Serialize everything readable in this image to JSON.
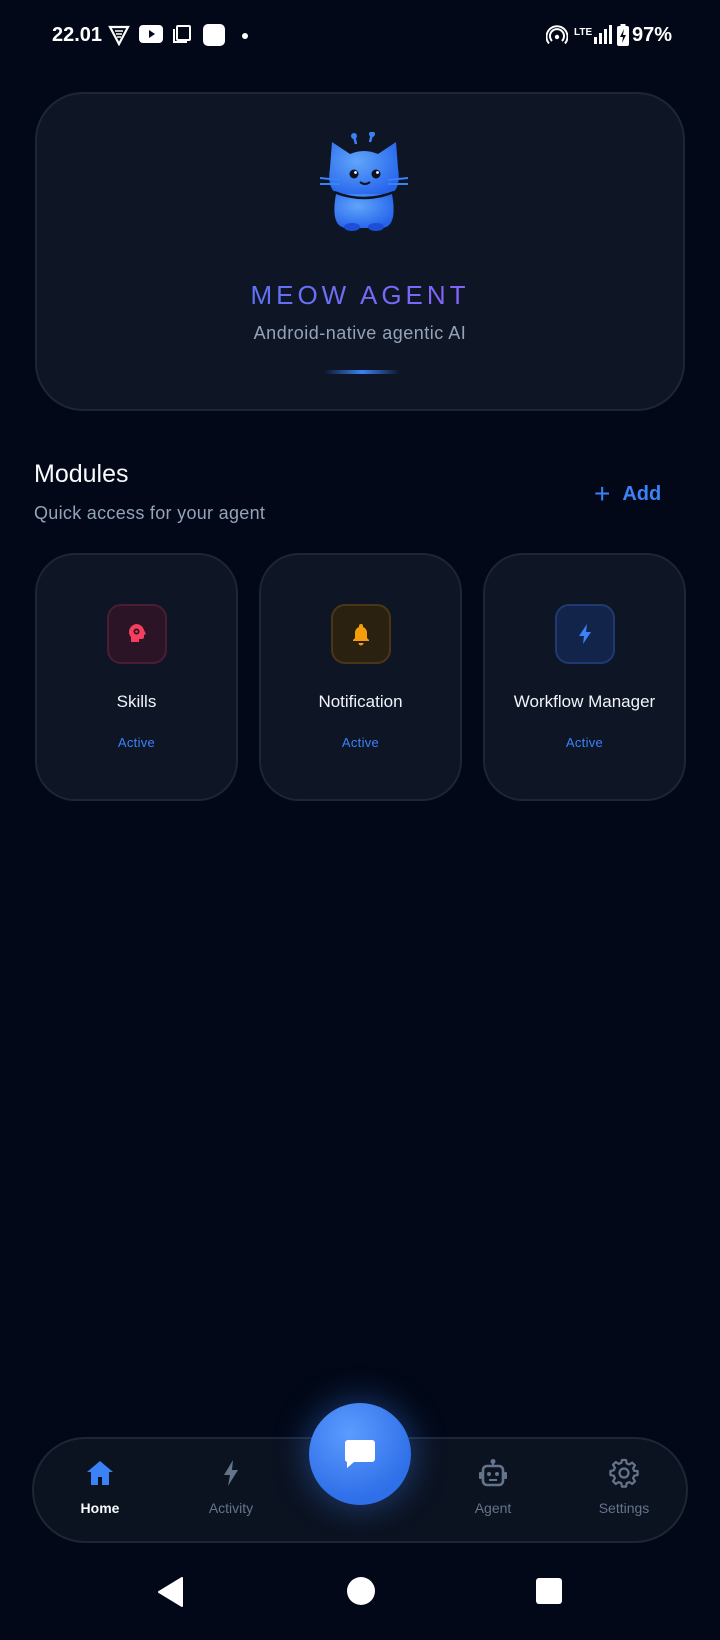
{
  "status_bar": {
    "time": "22.01",
    "battery_percent": "97%",
    "network": "LTE",
    "icons": [
      "vpn-icon",
      "youtube-icon",
      "copy-icon",
      "app-icon",
      "dot-icon",
      "hotspot-icon",
      "signal-icon",
      "battery-charging-icon"
    ]
  },
  "hero": {
    "title": "MEOW AGENT",
    "subtitle": "Android-native agentic AI",
    "mascot_icon": "cat-robot-icon"
  },
  "modules": {
    "title": "Modules",
    "subtitle": "Quick access for your agent",
    "add_label": "Add",
    "items": [
      {
        "name": "Skills",
        "status": "Active",
        "icon": "brain-gear-icon",
        "color": "#f43f5e"
      },
      {
        "name": "Notification",
        "status": "Active",
        "icon": "bell-icon",
        "color": "#f59e0b"
      },
      {
        "name": "Workflow Manager",
        "status": "Active",
        "icon": "bolt-icon",
        "color": "#3b82f6"
      }
    ]
  },
  "nav": {
    "items": [
      {
        "label": "Home",
        "icon": "home-icon",
        "active": true
      },
      {
        "label": "Activity",
        "icon": "bolt-icon",
        "active": false
      },
      {
        "label": "Agent",
        "icon": "robot-icon",
        "active": false
      },
      {
        "label": "Settings",
        "icon": "gear-icon",
        "active": false
      }
    ],
    "fab_icon": "chat-icon"
  },
  "colors": {
    "background": "#020817",
    "card": "#0e1525",
    "accent": "#3b82f6",
    "title_gradient_end": "#a855f7"
  }
}
